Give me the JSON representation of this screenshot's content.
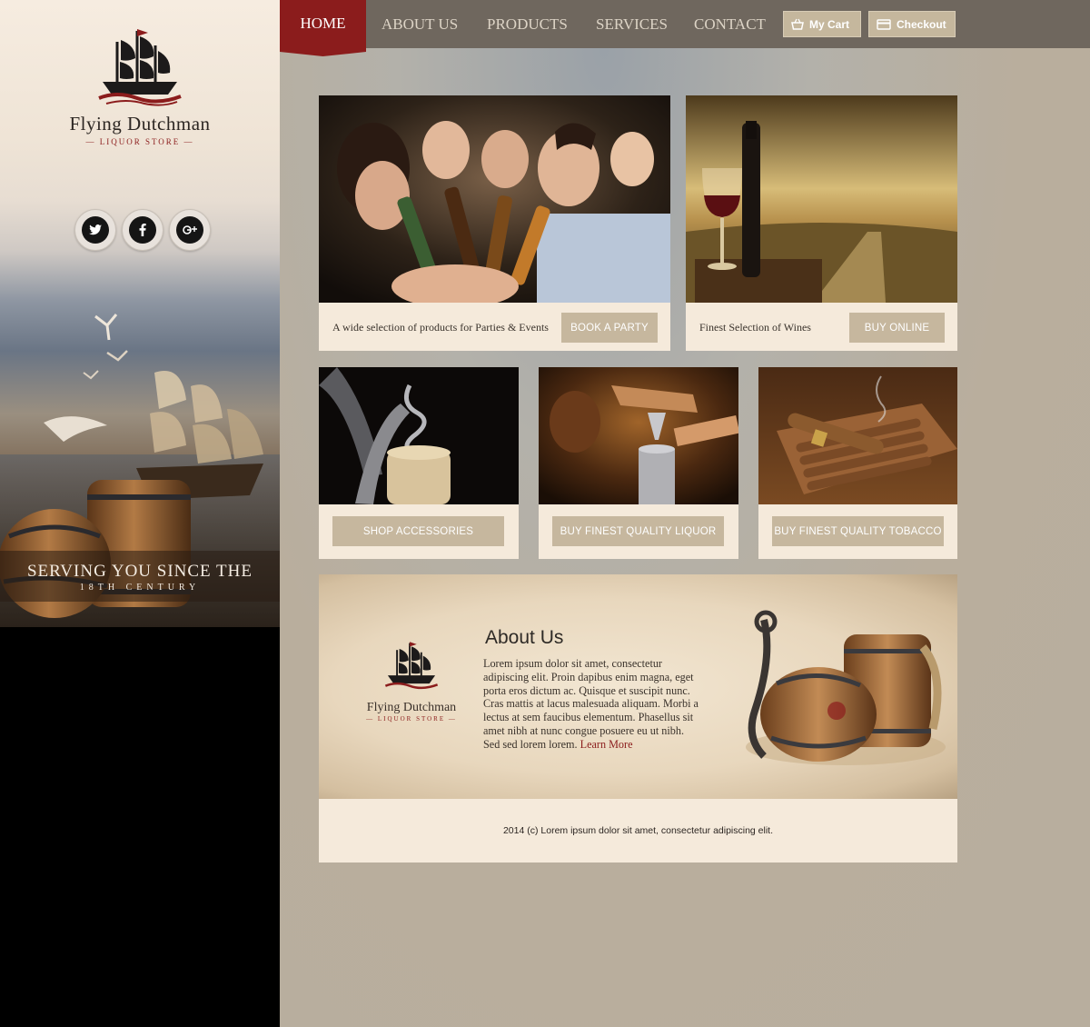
{
  "brand": {
    "name": "Flying Dutchman",
    "tagline": "LIQUOR STORE"
  },
  "sidebar": {
    "socials": [
      {
        "name": "twitter-icon",
        "glyph": "t"
      },
      {
        "name": "facebook-icon",
        "glyph": "f"
      },
      {
        "name": "google-plus-icon",
        "glyph": "g+"
      }
    ],
    "serving_main": "SERVING YOU SINCE THE",
    "serving_sub": "18TH CENTURY"
  },
  "nav": {
    "items": [
      "HOME",
      "ABOUT US",
      "PRODUCTS",
      "SERVICES",
      "CONTACT"
    ],
    "active": "HOME",
    "cart_label": "My Cart",
    "checkout_label": "Checkout"
  },
  "cards": {
    "party": {
      "caption": "A wide selection of products for Parties & Events",
      "button": "BOOK A PARTY"
    },
    "wine": {
      "caption": "Finest Selection of Wines",
      "button": "BUY ONLINE"
    },
    "accessories": {
      "button": "SHOP ACCESSORIES"
    },
    "liquor": {
      "button": "BUY FINEST QUALITY LIQUOR"
    },
    "tobacco": {
      "button": "BUY FINEST QUALITY TOBACCO"
    }
  },
  "about": {
    "title": "About Us",
    "text": "Lorem ipsum dolor sit amet, consectetur adipiscing elit. Proin dapibus enim magna, eget porta eros dictum ac. Quisque et suscipit nunc. Cras mattis at lacus malesuada aliquam. Morbi a lectus at sem faucibus elementum. Phasellus sit amet nibh at nunc congue posuere eu ut nibh. Sed sed lorem lorem.",
    "link": "Learn More"
  },
  "footer": {
    "text": "2014 (c) Lorem ipsum dolor sit amet, consectetur adipiscing elit."
  },
  "colors": {
    "accent": "#8b1c1c",
    "button": "#c6b79e",
    "card": "#f5eadb",
    "page": "#b8ae9e"
  }
}
